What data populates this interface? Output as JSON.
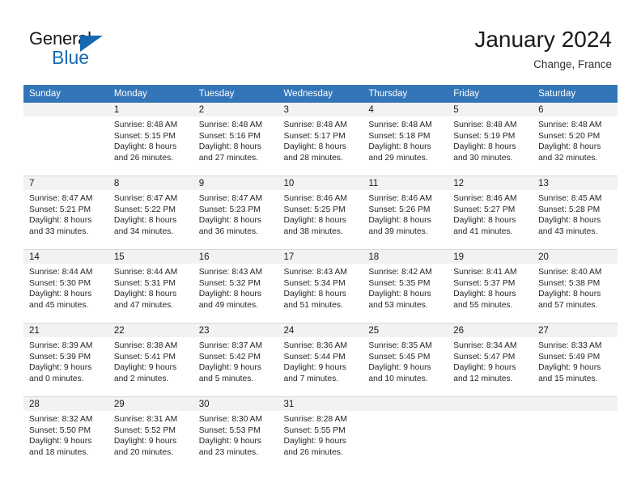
{
  "logo": {
    "word1": "General",
    "word2": "Blue",
    "triangle_color": "#1569b0"
  },
  "header": {
    "title": "January 2024",
    "subtitle": "Change, France"
  },
  "calendar": {
    "header_bg": "#3275b8",
    "daynum_bg": "#f2f2f2",
    "weekdays": [
      "Sunday",
      "Monday",
      "Tuesday",
      "Wednesday",
      "Thursday",
      "Friday",
      "Saturday"
    ],
    "weeks": [
      [
        {
          "day": "",
          "sunrise": "",
          "sunset": "",
          "daylight1": "",
          "daylight2": ""
        },
        {
          "day": "1",
          "sunrise": "Sunrise: 8:48 AM",
          "sunset": "Sunset: 5:15 PM",
          "daylight1": "Daylight: 8 hours",
          "daylight2": "and 26 minutes."
        },
        {
          "day": "2",
          "sunrise": "Sunrise: 8:48 AM",
          "sunset": "Sunset: 5:16 PM",
          "daylight1": "Daylight: 8 hours",
          "daylight2": "and 27 minutes."
        },
        {
          "day": "3",
          "sunrise": "Sunrise: 8:48 AM",
          "sunset": "Sunset: 5:17 PM",
          "daylight1": "Daylight: 8 hours",
          "daylight2": "and 28 minutes."
        },
        {
          "day": "4",
          "sunrise": "Sunrise: 8:48 AM",
          "sunset": "Sunset: 5:18 PM",
          "daylight1": "Daylight: 8 hours",
          "daylight2": "and 29 minutes."
        },
        {
          "day": "5",
          "sunrise": "Sunrise: 8:48 AM",
          "sunset": "Sunset: 5:19 PM",
          "daylight1": "Daylight: 8 hours",
          "daylight2": "and 30 minutes."
        },
        {
          "day": "6",
          "sunrise": "Sunrise: 8:48 AM",
          "sunset": "Sunset: 5:20 PM",
          "daylight1": "Daylight: 8 hours",
          "daylight2": "and 32 minutes."
        }
      ],
      [
        {
          "day": "7",
          "sunrise": "Sunrise: 8:47 AM",
          "sunset": "Sunset: 5:21 PM",
          "daylight1": "Daylight: 8 hours",
          "daylight2": "and 33 minutes."
        },
        {
          "day": "8",
          "sunrise": "Sunrise: 8:47 AM",
          "sunset": "Sunset: 5:22 PM",
          "daylight1": "Daylight: 8 hours",
          "daylight2": "and 34 minutes."
        },
        {
          "day": "9",
          "sunrise": "Sunrise: 8:47 AM",
          "sunset": "Sunset: 5:23 PM",
          "daylight1": "Daylight: 8 hours",
          "daylight2": "and 36 minutes."
        },
        {
          "day": "10",
          "sunrise": "Sunrise: 8:46 AM",
          "sunset": "Sunset: 5:25 PM",
          "daylight1": "Daylight: 8 hours",
          "daylight2": "and 38 minutes."
        },
        {
          "day": "11",
          "sunrise": "Sunrise: 8:46 AM",
          "sunset": "Sunset: 5:26 PM",
          "daylight1": "Daylight: 8 hours",
          "daylight2": "and 39 minutes."
        },
        {
          "day": "12",
          "sunrise": "Sunrise: 8:46 AM",
          "sunset": "Sunset: 5:27 PM",
          "daylight1": "Daylight: 8 hours",
          "daylight2": "and 41 minutes."
        },
        {
          "day": "13",
          "sunrise": "Sunrise: 8:45 AM",
          "sunset": "Sunset: 5:28 PM",
          "daylight1": "Daylight: 8 hours",
          "daylight2": "and 43 minutes."
        }
      ],
      [
        {
          "day": "14",
          "sunrise": "Sunrise: 8:44 AM",
          "sunset": "Sunset: 5:30 PM",
          "daylight1": "Daylight: 8 hours",
          "daylight2": "and 45 minutes."
        },
        {
          "day": "15",
          "sunrise": "Sunrise: 8:44 AM",
          "sunset": "Sunset: 5:31 PM",
          "daylight1": "Daylight: 8 hours",
          "daylight2": "and 47 minutes."
        },
        {
          "day": "16",
          "sunrise": "Sunrise: 8:43 AM",
          "sunset": "Sunset: 5:32 PM",
          "daylight1": "Daylight: 8 hours",
          "daylight2": "and 49 minutes."
        },
        {
          "day": "17",
          "sunrise": "Sunrise: 8:43 AM",
          "sunset": "Sunset: 5:34 PM",
          "daylight1": "Daylight: 8 hours",
          "daylight2": "and 51 minutes."
        },
        {
          "day": "18",
          "sunrise": "Sunrise: 8:42 AM",
          "sunset": "Sunset: 5:35 PM",
          "daylight1": "Daylight: 8 hours",
          "daylight2": "and 53 minutes."
        },
        {
          "day": "19",
          "sunrise": "Sunrise: 8:41 AM",
          "sunset": "Sunset: 5:37 PM",
          "daylight1": "Daylight: 8 hours",
          "daylight2": "and 55 minutes."
        },
        {
          "day": "20",
          "sunrise": "Sunrise: 8:40 AM",
          "sunset": "Sunset: 5:38 PM",
          "daylight1": "Daylight: 8 hours",
          "daylight2": "and 57 minutes."
        }
      ],
      [
        {
          "day": "21",
          "sunrise": "Sunrise: 8:39 AM",
          "sunset": "Sunset: 5:39 PM",
          "daylight1": "Daylight: 9 hours",
          "daylight2": "and 0 minutes."
        },
        {
          "day": "22",
          "sunrise": "Sunrise: 8:38 AM",
          "sunset": "Sunset: 5:41 PM",
          "daylight1": "Daylight: 9 hours",
          "daylight2": "and 2 minutes."
        },
        {
          "day": "23",
          "sunrise": "Sunrise: 8:37 AM",
          "sunset": "Sunset: 5:42 PM",
          "daylight1": "Daylight: 9 hours",
          "daylight2": "and 5 minutes."
        },
        {
          "day": "24",
          "sunrise": "Sunrise: 8:36 AM",
          "sunset": "Sunset: 5:44 PM",
          "daylight1": "Daylight: 9 hours",
          "daylight2": "and 7 minutes."
        },
        {
          "day": "25",
          "sunrise": "Sunrise: 8:35 AM",
          "sunset": "Sunset: 5:45 PM",
          "daylight1": "Daylight: 9 hours",
          "daylight2": "and 10 minutes."
        },
        {
          "day": "26",
          "sunrise": "Sunrise: 8:34 AM",
          "sunset": "Sunset: 5:47 PM",
          "daylight1": "Daylight: 9 hours",
          "daylight2": "and 12 minutes."
        },
        {
          "day": "27",
          "sunrise": "Sunrise: 8:33 AM",
          "sunset": "Sunset: 5:49 PM",
          "daylight1": "Daylight: 9 hours",
          "daylight2": "and 15 minutes."
        }
      ],
      [
        {
          "day": "28",
          "sunrise": "Sunrise: 8:32 AM",
          "sunset": "Sunset: 5:50 PM",
          "daylight1": "Daylight: 9 hours",
          "daylight2": "and 18 minutes."
        },
        {
          "day": "29",
          "sunrise": "Sunrise: 8:31 AM",
          "sunset": "Sunset: 5:52 PM",
          "daylight1": "Daylight: 9 hours",
          "daylight2": "and 20 minutes."
        },
        {
          "day": "30",
          "sunrise": "Sunrise: 8:30 AM",
          "sunset": "Sunset: 5:53 PM",
          "daylight1": "Daylight: 9 hours",
          "daylight2": "and 23 minutes."
        },
        {
          "day": "31",
          "sunrise": "Sunrise: 8:28 AM",
          "sunset": "Sunset: 5:55 PM",
          "daylight1": "Daylight: 9 hours",
          "daylight2": "and 26 minutes."
        },
        {
          "day": "",
          "sunrise": "",
          "sunset": "",
          "daylight1": "",
          "daylight2": ""
        },
        {
          "day": "",
          "sunrise": "",
          "sunset": "",
          "daylight1": "",
          "daylight2": ""
        },
        {
          "day": "",
          "sunrise": "",
          "sunset": "",
          "daylight1": "",
          "daylight2": ""
        }
      ]
    ]
  }
}
